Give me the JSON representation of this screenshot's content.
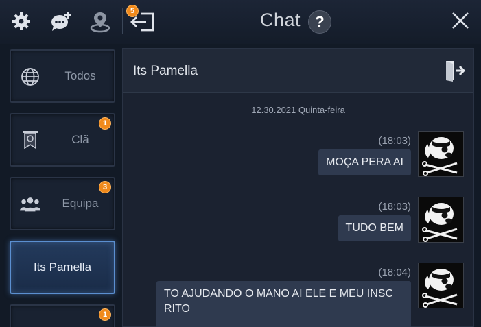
{
  "topbar": {
    "icons": [
      "gear-icon",
      "add-chat-icon",
      "location-icon",
      "exit-to-chat-icon"
    ],
    "exit_badge": "5",
    "title": "Chat",
    "help_label": "?"
  },
  "sidebar": {
    "items": [
      {
        "label": "Todos",
        "icon": "globe-icon",
        "badge": ""
      },
      {
        "label": "Clã",
        "icon": "clan-banner-icon",
        "badge": "1"
      },
      {
        "label": "Equipa",
        "icon": "team-icon",
        "badge": "3"
      },
      {
        "label": "Its Pamella",
        "icon": "",
        "badge": ""
      },
      {
        "label": "",
        "icon": "",
        "badge": "1"
      }
    ]
  },
  "conversation": {
    "contact_name": "Its Pamella",
    "date_separator": "12.30.2021 Quinta-feira",
    "messages": [
      {
        "time": "(18:03)",
        "lines": [
          "MOÇA PERA AI"
        ]
      },
      {
        "time": "(18:03)",
        "lines": [
          "TUDO BEM"
        ]
      },
      {
        "time": "(18:04)",
        "lines": [
          "TO AJUDANDO O MANO AI ELE E MEU INSC",
          "RITO"
        ]
      }
    ]
  },
  "colors": {
    "badge": "#f08a1c",
    "active_border": "#5b8fd0",
    "bubble": "#2f3a4f"
  }
}
